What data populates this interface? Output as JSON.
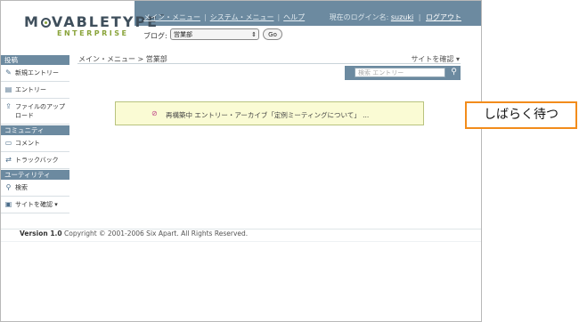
{
  "header": {
    "logo_main": "MOVABLETYPE",
    "logo_tm": "™",
    "logo_sub": "ENTERPRISE",
    "nav": [
      {
        "label": "メイン・メニュー"
      },
      {
        "label": "システム・メニュー"
      },
      {
        "label": "ヘルプ"
      }
    ],
    "login_prefix": "現在のログイン名:",
    "login_user": "suzuki",
    "logout": "ログアウト",
    "blog_label": "ブログ:",
    "blog_selected": "営業部",
    "go_label": "Go"
  },
  "sidebar": {
    "sections": [
      {
        "title": "投稿",
        "items": [
          {
            "label": "新規エントリー",
            "icon": "new-entry-icon"
          },
          {
            "label": "エントリー",
            "icon": "entry-icon"
          },
          {
            "label": "ファイルのアップロード",
            "icon": "upload-icon"
          }
        ]
      },
      {
        "title": "コミュニティ",
        "items": [
          {
            "label": "コメント",
            "icon": "comment-icon"
          },
          {
            "label": "トラックバック",
            "icon": "trackback-icon"
          }
        ]
      },
      {
        "title": "ユーティリティ",
        "items": [
          {
            "label": "検索",
            "icon": "search-icon"
          },
          {
            "label": "サイトを確認 ▾",
            "icon": "site-icon"
          }
        ]
      }
    ]
  },
  "main": {
    "breadcrumb": "メイン・メニュー > 営業部",
    "site_check": "サイトを確認 ▾",
    "search_placeholder": "検索 エントリー",
    "message": "再構築中 エントリー・アーカイブ「定例ミーティングについて」 ..."
  },
  "footer": {
    "version": "Version 1.0",
    "copyright": "Copyright © 2001-2006 Six Apart. All Rights Reserved."
  },
  "overlay": {
    "label": "しばらく待つ"
  },
  "colors": {
    "header_band": "#6c8aa0",
    "accent_green": "#8aa43b",
    "message_bg": "#fafbd4",
    "overlay_border": "#f28c1b"
  }
}
